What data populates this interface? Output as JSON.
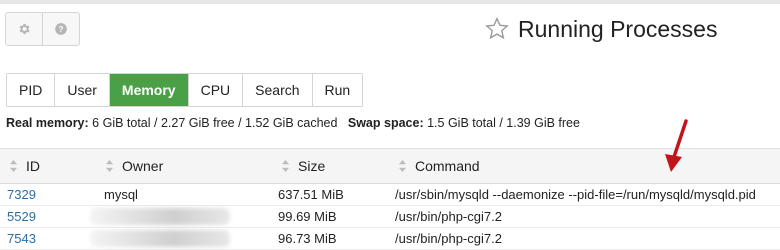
{
  "header": {
    "title": "Running Processes",
    "icons": [
      "gear-icon",
      "help-icon",
      "star-icon"
    ]
  },
  "tabs": [
    {
      "label": "PID",
      "active": false
    },
    {
      "label": "User",
      "active": false
    },
    {
      "label": "Memory",
      "active": true
    },
    {
      "label": "CPU",
      "active": false
    },
    {
      "label": "Search",
      "active": false
    },
    {
      "label": "Run",
      "active": false
    }
  ],
  "info": {
    "real_label": "Real memory:",
    "real_value": "6 GiB total / 2.27 GiB free / 1.52 GiB cached",
    "swap_label": "Swap space:",
    "swap_value": "1.5 GiB total / 1.39 GiB free"
  },
  "table": {
    "columns": [
      "ID",
      "Owner",
      "Size",
      "Command"
    ],
    "rows": [
      {
        "id": "7329",
        "owner": "mysql",
        "size": "637.51 MiB",
        "command": "/usr/sbin/mysqld --daemonize --pid-file=/run/mysqld/mysqld.pid"
      },
      {
        "id": "5529",
        "owner": "",
        "size": "99.69 MiB",
        "command": "/usr/bin/php-cgi7.2"
      },
      {
        "id": "7543",
        "owner": "",
        "size": "96.73 MiB",
        "command": "/usr/bin/php-cgi7.2"
      }
    ]
  },
  "colors": {
    "active_tab": "#4aa046",
    "link": "#2e6da4",
    "arrow": "#c0151b"
  }
}
